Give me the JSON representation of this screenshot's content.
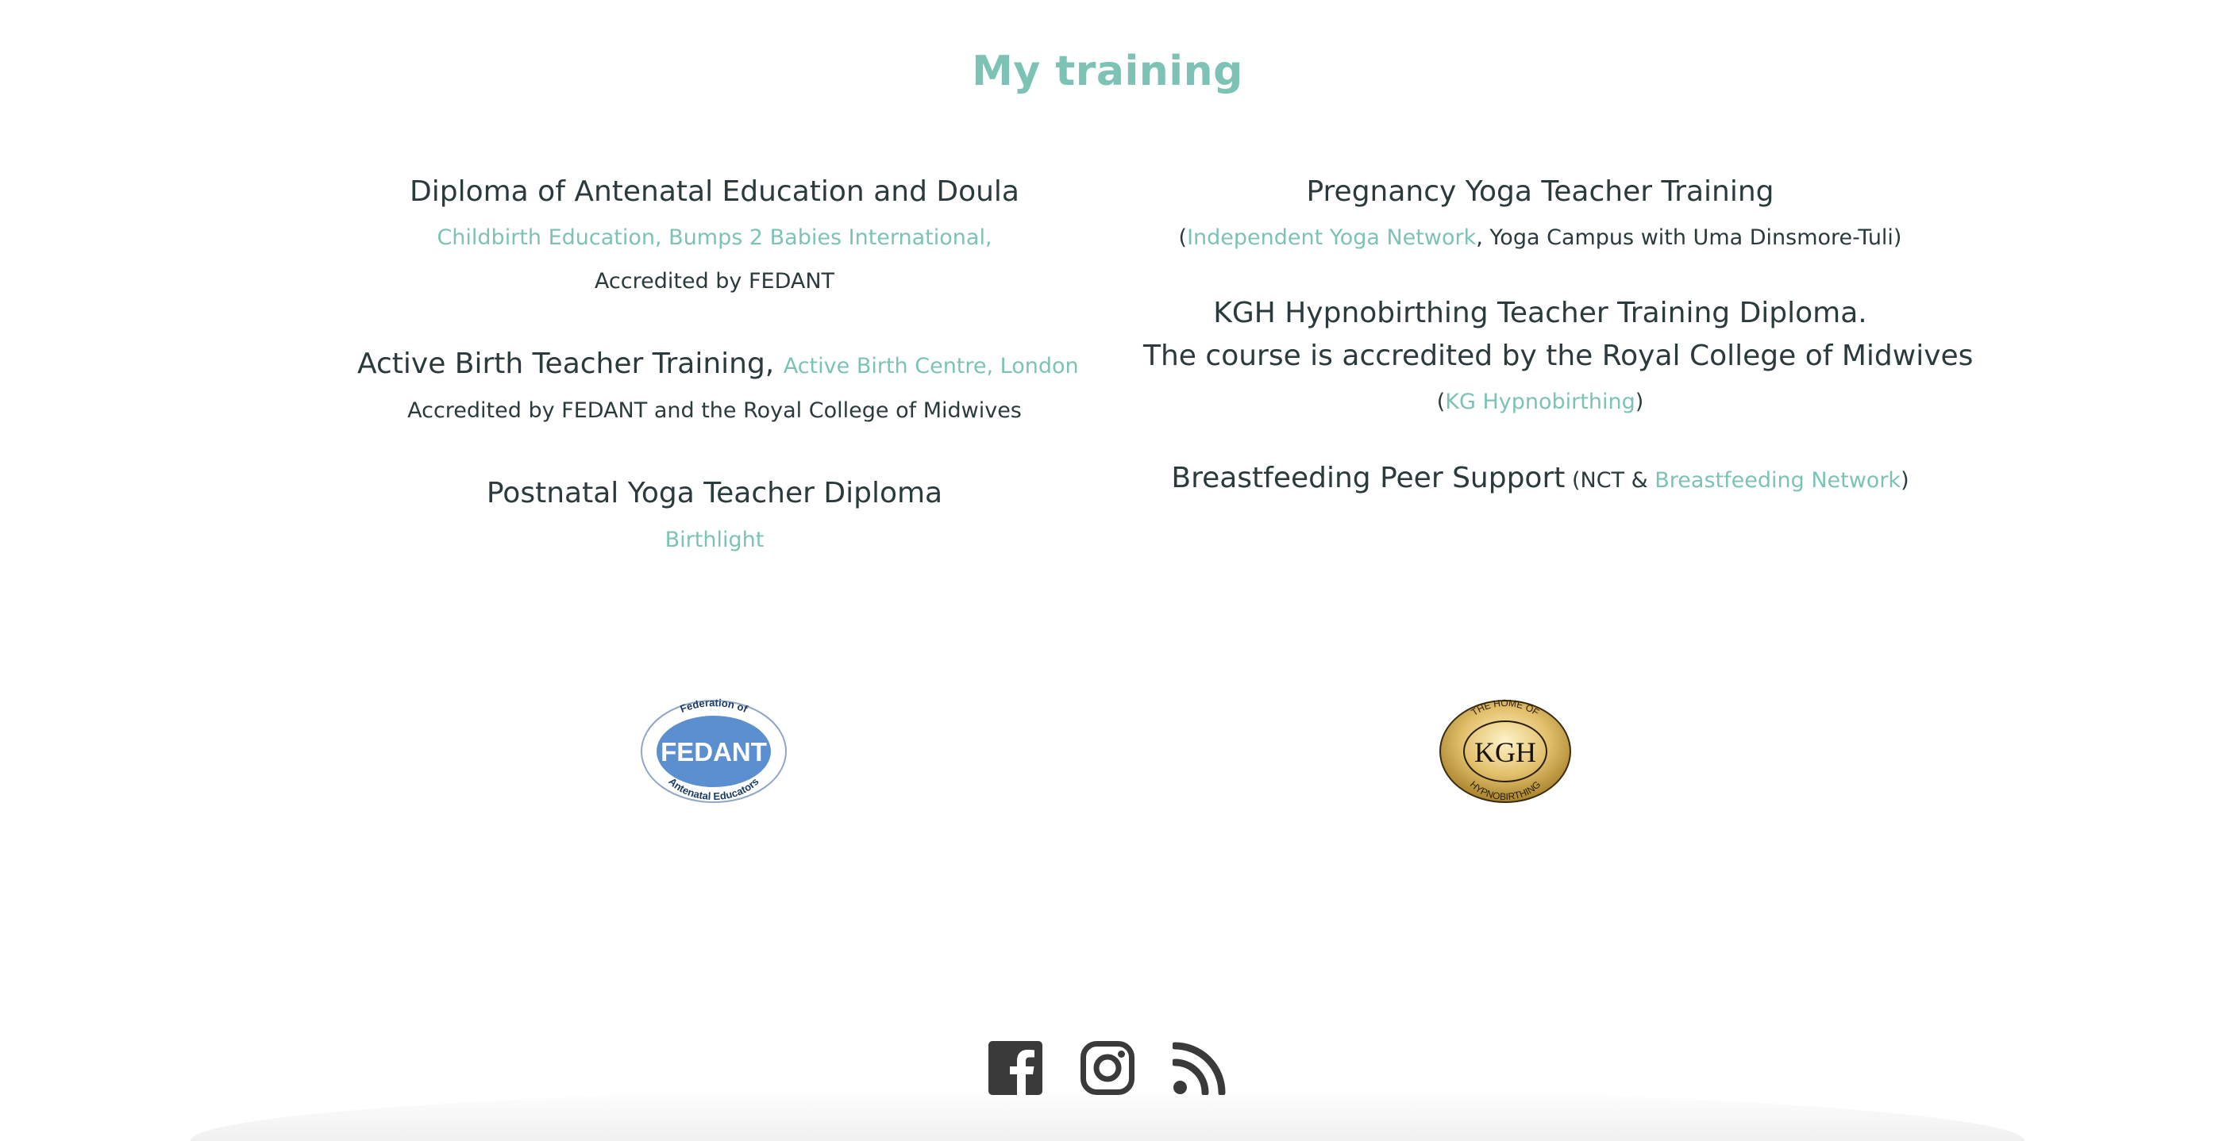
{
  "page": {
    "title": "My training"
  },
  "left": {
    "diploma": {
      "title": "Diploma of Antenatal Education and Doula",
      "provider": "Childbirth Education, Bumps 2 Babies International,",
      "accreditation": "Accredited by FEDANT"
    },
    "active_birth": {
      "title": "Active Birth Teacher Training,",
      "provider": "Active Birth Centre, London",
      "accreditation": "Accredited by FEDANT and the Royal College of Midwives"
    },
    "postnatal": {
      "title": "Postnatal Yoga Teacher Diploma",
      "provider": "Birthlight"
    }
  },
  "right": {
    "pregnancy_yoga": {
      "title": "Pregnancy Yoga Teacher Training",
      "open_paren": "(",
      "provider": "Independent Yoga Network",
      "rest": ", Yoga Campus with Uma Dinsmore-Tuli)"
    },
    "kgh": {
      "line1": "KGH Hypnobirthing Teacher Training Diploma.",
      "line2": "The course is accredited by the Royal College of Midwives",
      "open_paren": "(",
      "provider": "KG Hypnobirthing",
      "close_paren": ")"
    },
    "breastfeeding": {
      "title": "Breastfeeding Peer Support",
      "prefix": " (NCT & ",
      "provider": "Breastfeeding Network",
      "close_paren": ")"
    }
  },
  "logos": {
    "fedant": {
      "top_text": "Federation of",
      "main_text": "FEDANT",
      "bottom_text": "Antenatal Educators",
      "color": "#5b8fd0"
    },
    "kgh": {
      "top_text": "THE HOME OF",
      "main_text": "KGH",
      "bottom_text": "HYPNOBIRTHING",
      "color": "#d8b25a"
    }
  },
  "social": {
    "icons": [
      "facebook-icon",
      "instagram-icon",
      "rss-icon"
    ],
    "color": "#3a3a3a"
  },
  "colors": {
    "accent": "#7cc3b5",
    "text": "#2b3a3c"
  }
}
